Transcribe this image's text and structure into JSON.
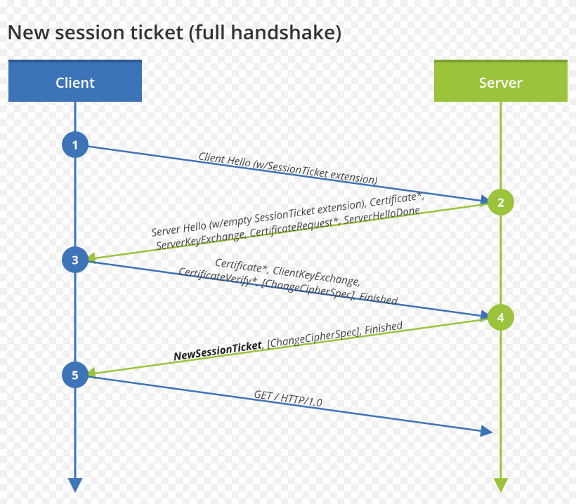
{
  "title": "New session ticket (full handshake)",
  "participants": {
    "client": "Client",
    "server": "Server"
  },
  "colors": {
    "client": "#3d73b7",
    "server": "#9bc43c"
  },
  "steps": {
    "s1": "1",
    "s2": "2",
    "s3": "3",
    "s4": "4",
    "s5": "5"
  },
  "messages": {
    "m1": "Client Hello (w/SessionTicket extension)",
    "m2a": "Server Hello (w/empty SessionTicket extension), Certificate*,",
    "m2b": "ServerKeyExchange, CertificateRequest*, ServerHelloDone",
    "m3a": "Certificate*, ClientKeyExchange,",
    "m3b": "CertificateVerify*, [ChangeCipherSpec], Finished",
    "m4_bold": "NewSessionTicket",
    "m4_rest": ", [ChangeCipherSpec], Finished",
    "m5": "GET / HTTP/1.0"
  }
}
